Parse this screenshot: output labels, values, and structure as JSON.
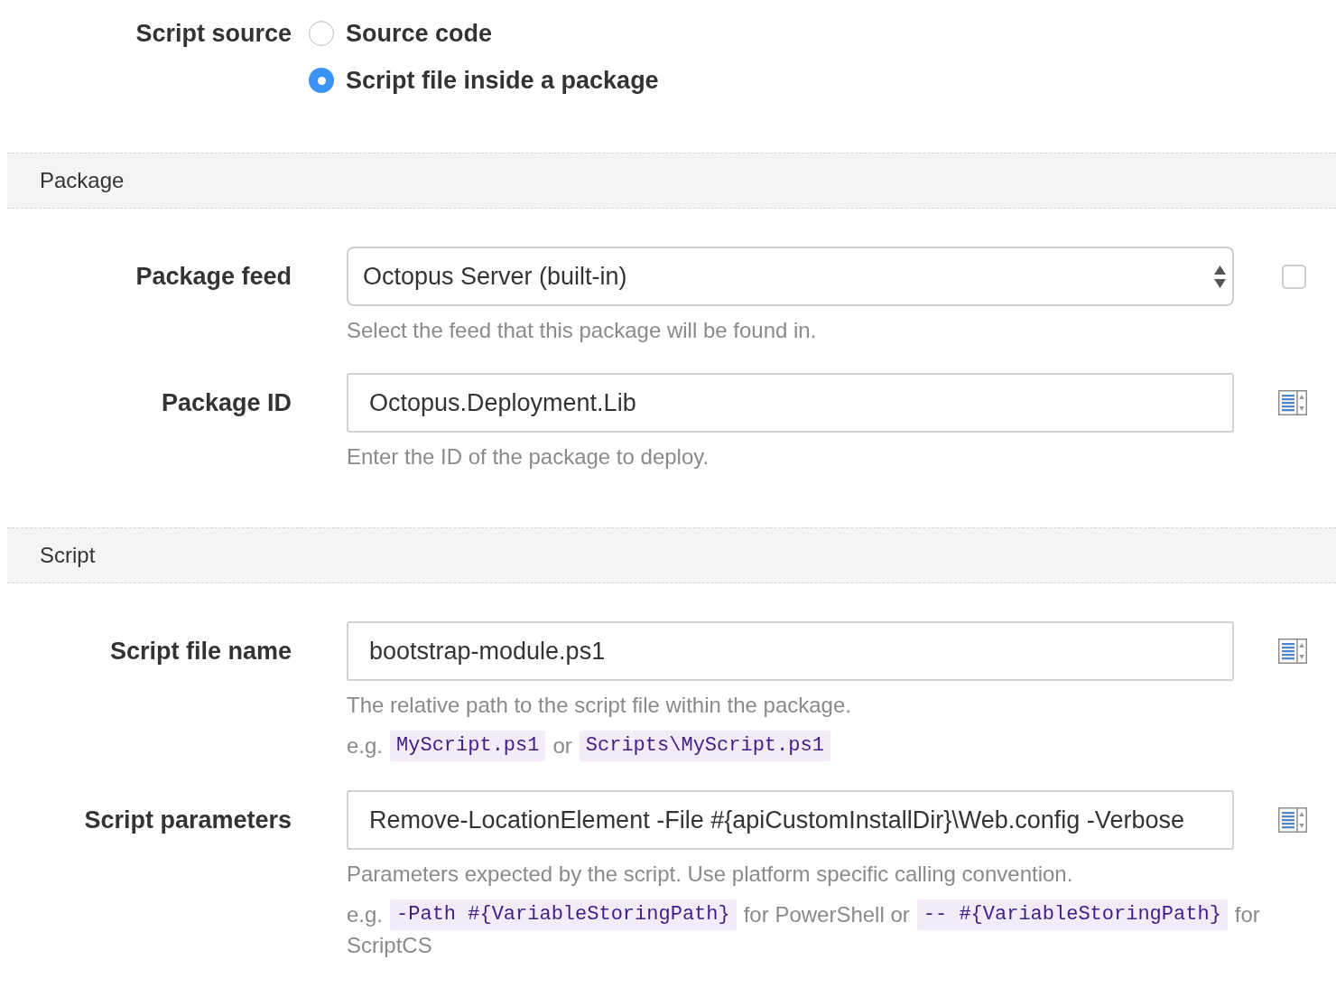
{
  "script_source": {
    "label": "Script source",
    "options": [
      {
        "label": "Source code",
        "selected": false
      },
      {
        "label": "Script file inside a package",
        "selected": true
      }
    ]
  },
  "sections": [
    {
      "title": "Package",
      "fields": [
        {
          "kind": "select",
          "label": "Package feed",
          "value": "Octopus Server (built-in)",
          "help": "Select the feed that this package will be found in.",
          "addon": {
            "kind": "checkbox",
            "checked": false
          }
        },
        {
          "kind": "input",
          "label": "Package ID",
          "value": "Octopus.Deployment.Lib",
          "help": "Enter the ID of the package to deploy.",
          "addon": {
            "kind": "variable-picker"
          }
        }
      ]
    },
    {
      "title": "Script",
      "fields": [
        {
          "kind": "input",
          "label": "Script file name",
          "value": "bootstrap-module.ps1",
          "help": "The relative path to the script file within the package.",
          "example": [
            {
              "kind": "text",
              "text": "e.g."
            },
            {
              "kind": "code",
              "text": "MyScript.ps1"
            },
            {
              "kind": "text",
              "text": "or"
            },
            {
              "kind": "code",
              "text": "Scripts\\MyScript.ps1"
            }
          ],
          "addon": {
            "kind": "variable-picker"
          }
        },
        {
          "kind": "input",
          "label": "Script parameters",
          "value": "Remove-LocationElement -File #{apiCustomInstallDir}\\Web.config -Verbose",
          "help": "Parameters expected by the script. Use platform specific calling convention.",
          "example": [
            {
              "kind": "text",
              "text": "e.g."
            },
            {
              "kind": "code",
              "text": "-Path #{VariableStoringPath}"
            },
            {
              "kind": "text",
              "text": "for PowerShell or"
            },
            {
              "kind": "code",
              "text": "-- #{VariableStoringPath}"
            },
            {
              "kind": "text",
              "text": "for"
            },
            {
              "kind": "text",
              "text": "ScriptCS"
            }
          ],
          "addon": {
            "kind": "variable-picker"
          }
        }
      ]
    }
  ]
}
